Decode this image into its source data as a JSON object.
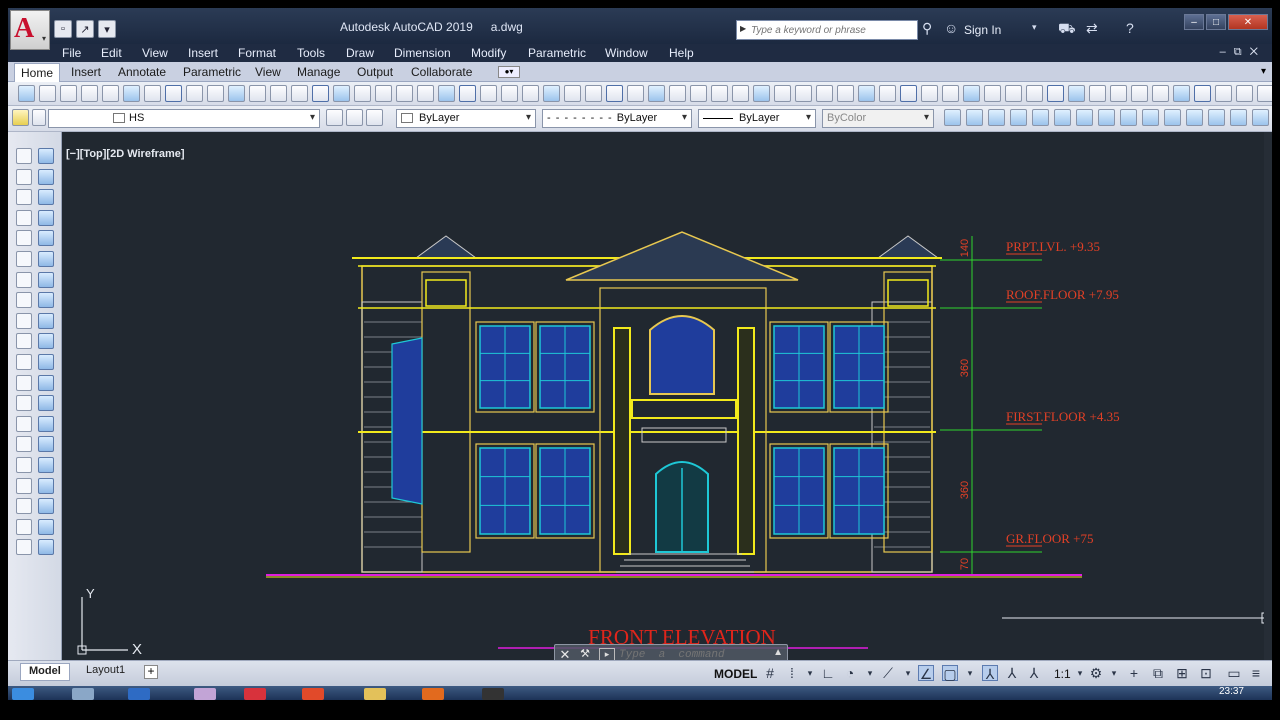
{
  "title": {
    "app": "Autodesk AutoCAD 2019",
    "file": "a.dwg"
  },
  "search": {
    "placeholder": "Type a keyword or phrase"
  },
  "signin": "Sign In",
  "menu": [
    "File",
    "Edit",
    "View",
    "Insert",
    "Format",
    "Tools",
    "Draw",
    "Dimension",
    "Modify",
    "Parametric",
    "Window",
    "Help"
  ],
  "ribbon_tabs": [
    "Home",
    "Insert",
    "Annotate",
    "Parametric",
    "View",
    "Manage",
    "Output",
    "Collaborate"
  ],
  "layer_combo": "HS",
  "properties": {
    "color": "ByLayer",
    "linetype": "ByLayer",
    "lineweight": "ByLayer",
    "plotstyle": "ByColor"
  },
  "viewport_label": "[−][Top][2D Wireframe]",
  "drawing": {
    "title": "FRONT  ELEVATION",
    "levels": [
      {
        "label": "PRPT.LVL. +9.35"
      },
      {
        "label": "ROOF.FLOOR +7.95"
      },
      {
        "label": "FIRST.FLOOR +4.35"
      },
      {
        "label": "GR.FLOOR  +75"
      }
    ],
    "dims": [
      "140",
      "360",
      "360",
      "70"
    ]
  },
  "command_line": {
    "placeholder": "Type  a  command"
  },
  "layout_tabs": [
    "Model",
    "Layout1"
  ],
  "status": {
    "model": "MODEL",
    "scale": "1:1"
  },
  "clock": "23:37",
  "ucs": {
    "x": "X",
    "y": "Y"
  },
  "colors": {
    "background": "#212830",
    "title_red": "#e0251b",
    "level_red": "#e24026",
    "wall_yellow": "#f2ea1c",
    "glass_blue": "#1f3d9c",
    "door_cyan": "#1ec8d6"
  }
}
